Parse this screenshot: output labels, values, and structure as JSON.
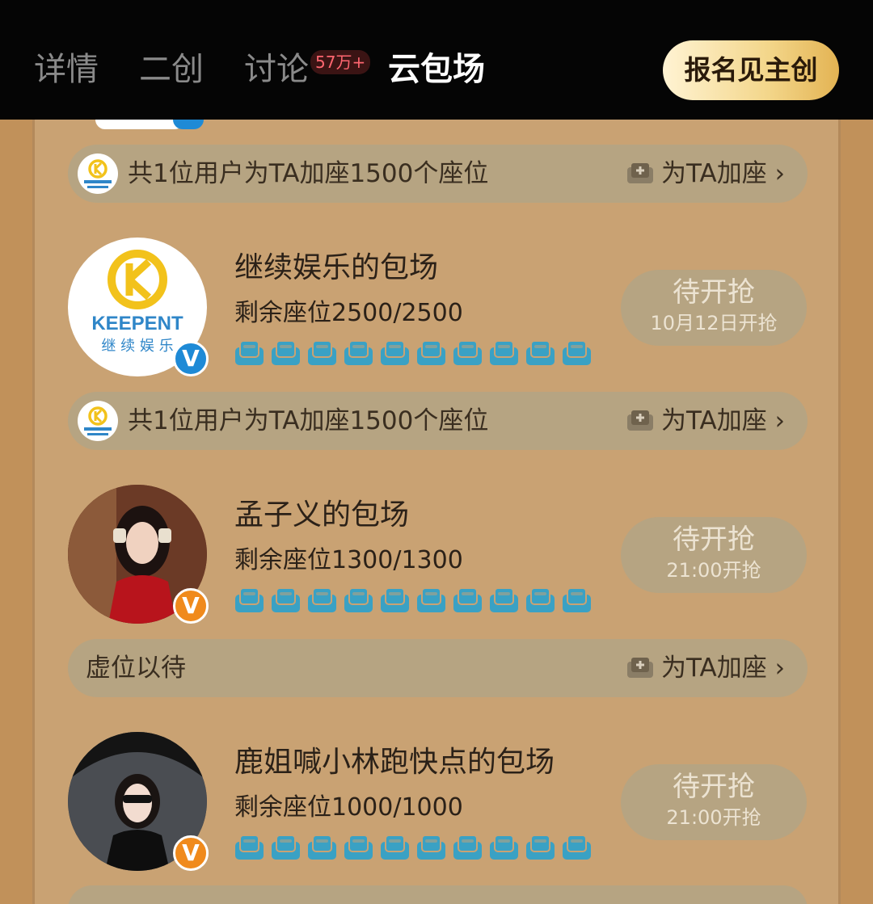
{
  "header": {
    "tabs": [
      {
        "label": "详情",
        "active": false
      },
      {
        "label": "二创",
        "active": false
      },
      {
        "label": "讨论",
        "active": false,
        "badge": "57万+"
      },
      {
        "label": "云包场",
        "active": true
      }
    ],
    "signup_label": "报名见主创"
  },
  "colors": {
    "background": "#c79a66",
    "pill": "#b6a482",
    "seat_icon": "#3aa1c4",
    "verified_blue": "#1e8ad6",
    "verified_orange": "#f08a1c"
  },
  "top_bar": {
    "text": "共1位用户为TA加座1500个座位",
    "action": "为TA加座 ›"
  },
  "rows": [
    {
      "title": "继续娱乐的包场",
      "seats": "剩余座位2500/2500",
      "button_main": "待开抢",
      "button_sub": "10月12日开抢",
      "avatar_icon": "keepent-logo",
      "logo_text": "KEEPENT",
      "logo_subtext": "继 续 娱 乐",
      "verified": "blue",
      "bar_text": "共1位用户为TA加座1500个座位",
      "bar_action": "为TA加座 ›"
    },
    {
      "title": "孟子义的包场",
      "seats": "剩余座位1300/1300",
      "button_main": "待开抢",
      "button_sub": "21:00开抢",
      "avatar_icon": "user-photo",
      "verified": "orange",
      "bar_text": "虚位以待",
      "bar_action": "为TA加座 ›"
    },
    {
      "title": "鹿姐喊小林跑快点的包场",
      "seats": "剩余座位1000/1000",
      "button_main": "待开抢",
      "button_sub": "21:00开抢",
      "avatar_icon": "user-photo",
      "verified": "orange"
    }
  ],
  "seat_icon_count": 10,
  "verified_mark": "V"
}
